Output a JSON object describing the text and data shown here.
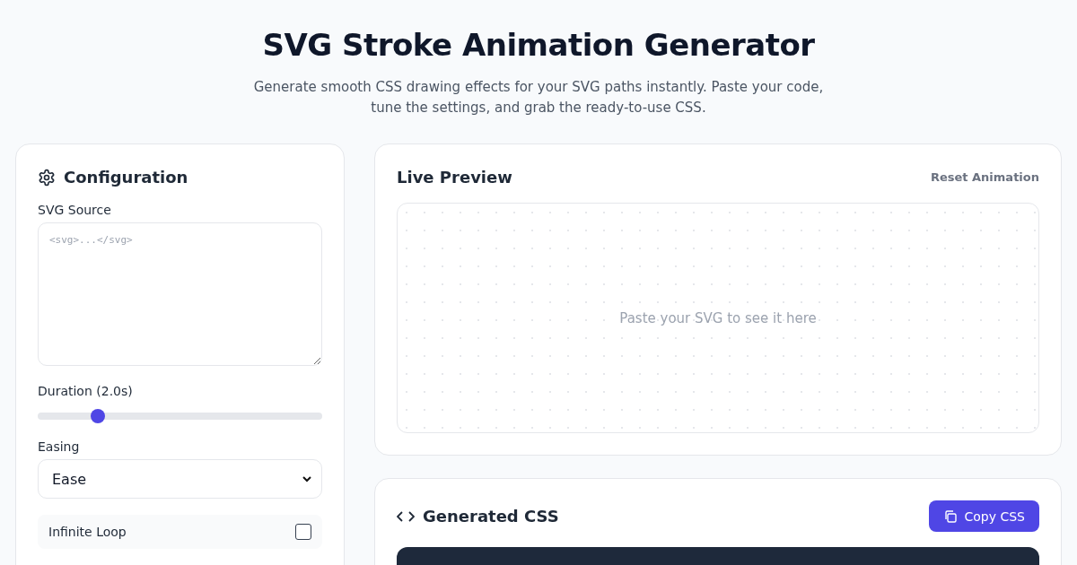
{
  "header": {
    "title": "SVG Stroke Animation Generator",
    "subtitle": "Generate smooth CSS drawing effects for your SVG paths instantly. Paste your code, tune the settings, and grab the ready-to-use CSS."
  },
  "config": {
    "title": "Configuration",
    "source_label": "SVG Source",
    "source_placeholder": "<svg>...</svg>",
    "duration_label": "Duration (2.0s)",
    "duration_slider": {
      "level": 0.21
    },
    "easing_label": "Easing",
    "easing_value": "Ease",
    "loop_label": "Infinite Loop",
    "loop_checked": false
  },
  "preview": {
    "title": "Live Preview",
    "reset": "Reset Animation",
    "empty": "Paste your SVG to see it here"
  },
  "css": {
    "title": "Generated CSS",
    "copy": "Copy CSS"
  }
}
